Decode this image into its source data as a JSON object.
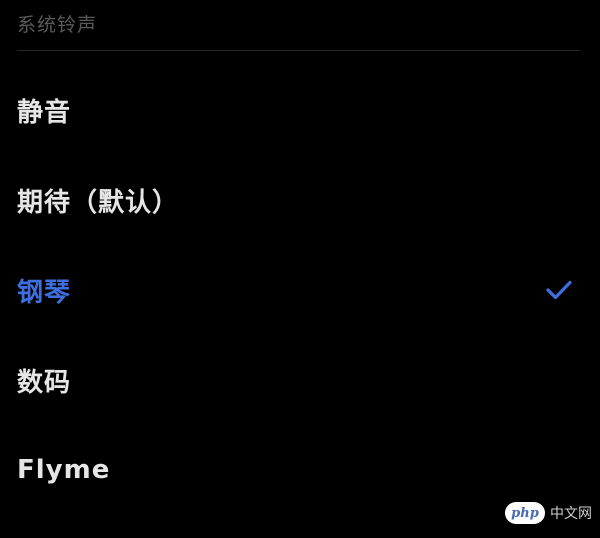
{
  "header": {
    "title": "系统铃声"
  },
  "ringtones": [
    {
      "label": "静音",
      "selected": false
    },
    {
      "label": "期待（默认）",
      "selected": false
    },
    {
      "label": "钢琴",
      "selected": true
    },
    {
      "label": "数码",
      "selected": false
    },
    {
      "label": "Flyme",
      "selected": false
    }
  ],
  "watermark": {
    "logo": "php",
    "text": "中文网"
  },
  "colors": {
    "background": "#000000",
    "selected_accent": "#3f6fde",
    "header_text": "#5a5a5a",
    "item_text": "#e6e6e6"
  },
  "icons": {
    "selected_marker": "checkmark-icon"
  }
}
